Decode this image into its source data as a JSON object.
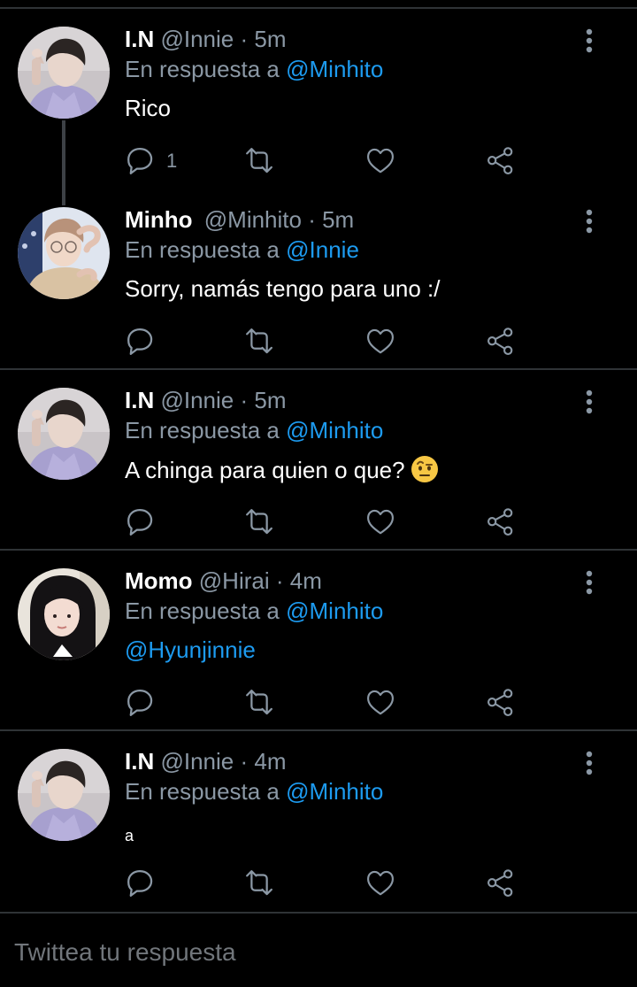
{
  "tweets": [
    {
      "name": "I.N",
      "handle": "@Innie",
      "time": "· 5m",
      "reply_prefix": "En respuesta a",
      "reply_to": "@Minhito",
      "text": "Rico",
      "reply_count": "1",
      "avatar": "in-avatar"
    },
    {
      "name": "Minho",
      "handle": "@Minhito",
      "time": "· 5m",
      "reply_prefix": "En respuesta a",
      "reply_to": "@Innie",
      "text": "Sorry, namás tengo para uno :/",
      "reply_count": "",
      "avatar": "minho-avatar"
    },
    {
      "name": "I.N",
      "handle": "@Innie",
      "time": "· 5m",
      "reply_prefix": "En respuesta a",
      "reply_to": "@Minhito",
      "text": "A chinga para quien o que?",
      "reply_count": "",
      "emoji": "face-with-raised-eyebrow",
      "avatar": "in-avatar"
    },
    {
      "name": "Momo",
      "handle": "@Hirai",
      "time": "· 4m",
      "reply_prefix": "En respuesta a",
      "reply_to": "@Minhito",
      "text": "@Hyunjinnie",
      "reply_count": "",
      "avatar": "momo-avatar"
    },
    {
      "name": "I.N",
      "handle": "@Innie",
      "time": "· 4m",
      "reply_prefix": "En respuesta a",
      "reply_to": "@Minhito",
      "text": "a",
      "reply_count": "",
      "avatar": "in-avatar"
    }
  ],
  "compose": {
    "placeholder": "Twittea tu respuesta"
  },
  "colors": {
    "background": "#000000",
    "divider": "#2f3336",
    "secondary_text": "#8b98a5",
    "accent": "#1d9bf0"
  },
  "icons": {
    "reply": "reply-icon",
    "retweet": "retweet-icon",
    "like": "heart-icon",
    "share": "share-icon",
    "menu": "more-vertical-icon"
  }
}
